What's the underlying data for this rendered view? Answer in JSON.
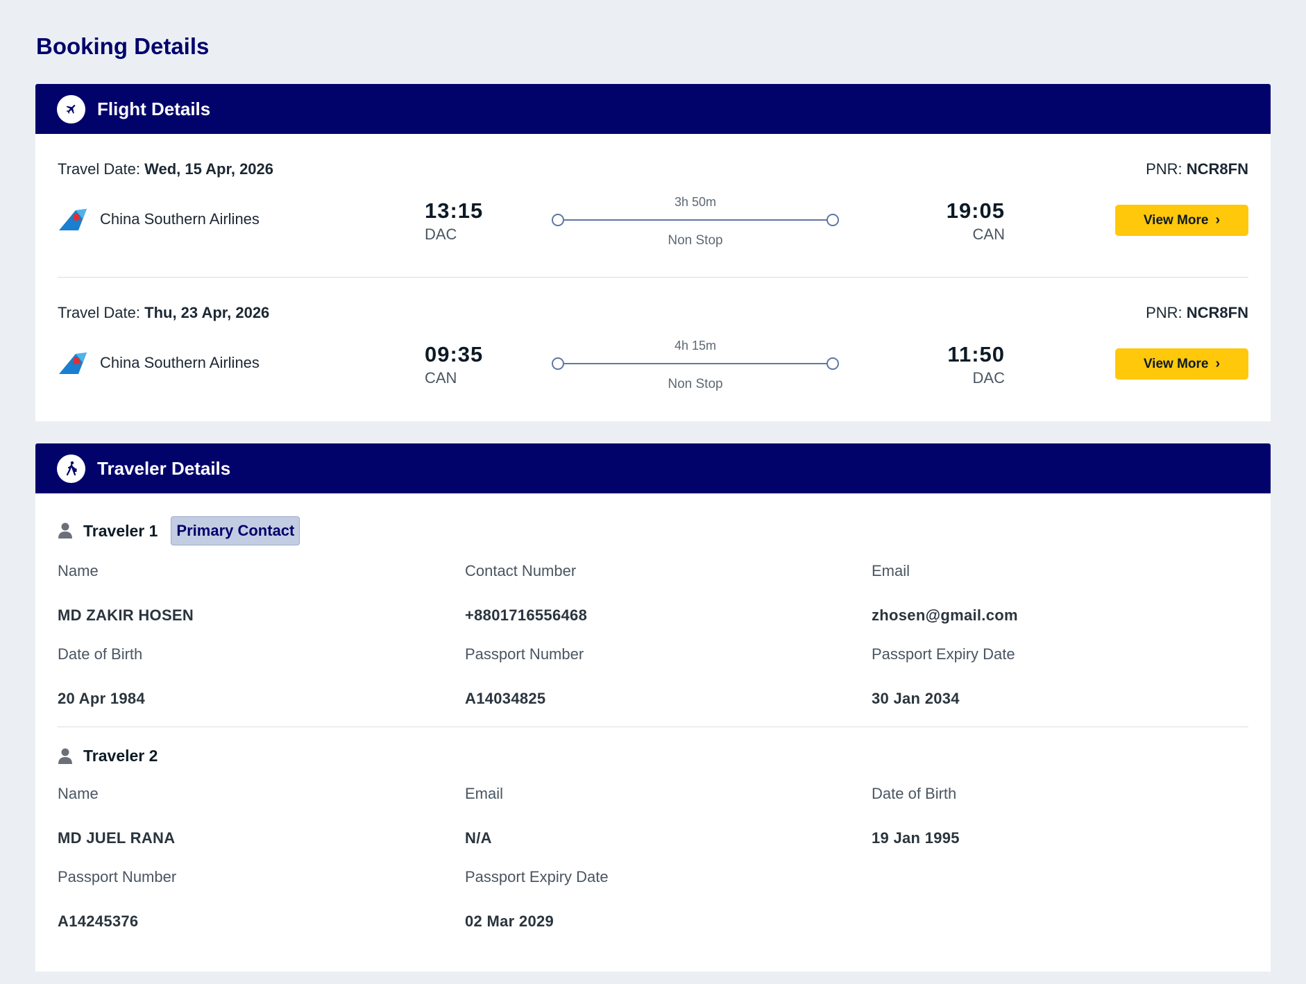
{
  "page": {
    "title": "Booking Details"
  },
  "flight_section": {
    "title": "Flight Details",
    "icon": "plane-icon",
    "travel_date_label": "Travel Date:",
    "pnr_label": "PNR:",
    "view_more_label": "View More",
    "flights": [
      {
        "date": "Wed, 15 Apr, 2026",
        "pnr": "NCR8FN",
        "airline": "China Southern Airlines",
        "dep_time": "13:15",
        "dep_code": "DAC",
        "duration": "3h 50m",
        "stops": "Non Stop",
        "arr_time": "19:05",
        "arr_code": "CAN"
      },
      {
        "date": "Thu, 23 Apr, 2026",
        "pnr": "NCR8FN",
        "airline": "China Southern Airlines",
        "dep_time": "09:35",
        "dep_code": "CAN",
        "duration": "4h 15m",
        "stops": "Non Stop",
        "arr_time": "11:50",
        "arr_code": "DAC"
      }
    ]
  },
  "traveler_section": {
    "title": "Traveler Details",
    "icon": "walking-person-icon",
    "travelers": [
      {
        "name": "Traveler 1",
        "badge": "Primary Contact",
        "fields": [
          {
            "label": "Name",
            "value": "MD ZAKIR HOSEN"
          },
          {
            "label": "Contact Number",
            "value": "+8801716556468"
          },
          {
            "label": "Email",
            "value": "zhosen@gmail.com"
          },
          {
            "label": "Date of Birth",
            "value": "20 Apr 1984"
          },
          {
            "label": "Passport Number",
            "value": "A14034825"
          },
          {
            "label": "Passport Expiry Date",
            "value": "30 Jan 2034"
          }
        ]
      },
      {
        "name": "Traveler 2",
        "fields": [
          {
            "label": "Name",
            "value": "MD JUEL RANA"
          },
          {
            "label": "Email",
            "value": "N/A"
          },
          {
            "label": "Date of Birth",
            "value": "19 Jan 1995"
          },
          {
            "label": "Passport Number",
            "value": "A14245376"
          },
          {
            "label": "Passport Expiry Date",
            "value": "02 Mar 2029"
          }
        ]
      }
    ]
  },
  "colors": {
    "brand_navy": "#02026b",
    "button_yellow": "#ffc80a",
    "badge_bg": "#c2cde3",
    "page_bg": "#ebeff4"
  }
}
